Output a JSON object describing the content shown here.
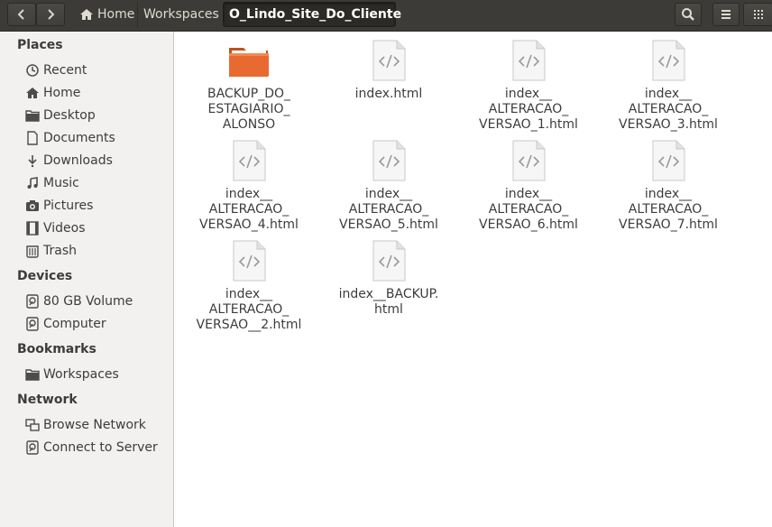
{
  "header": {
    "back_icon": "chevron-left",
    "forward_icon": "chevron-right",
    "breadcrumbs": [
      "Home",
      "Workspaces",
      "O_Lindo_Site_Do_Cliente"
    ],
    "search_icon": "search",
    "menu_icon": "hamburger",
    "view_icon": "grid"
  },
  "sidebar": {
    "places_title": "Places",
    "places": [
      "Recent",
      "Home",
      "Desktop",
      "Documents",
      "Downloads",
      "Music",
      "Pictures",
      "Videos",
      "Trash"
    ],
    "devices_title": "Devices",
    "devices": [
      "80 GB Volume",
      "Computer"
    ],
    "bookmarks_title": "Bookmarks",
    "bookmarks": [
      "Workspaces"
    ],
    "network_title": "Network",
    "network": [
      "Browse Network",
      "Connect to Server"
    ]
  },
  "files": [
    {
      "name": "BACKUP_DO_\nESTAGIARIO_\nALONSO",
      "type": "folder"
    },
    {
      "name": "index.html",
      "type": "html"
    },
    {
      "name": "index__\nALTERACAO_\nVERSAO_1.html",
      "type": "html"
    },
    {
      "name": "index__\nALTERACAO_\nVERSAO_3.html",
      "type": "html"
    },
    {
      "name": "index__\nALTERACAO_\nVERSAO_4.html",
      "type": "html"
    },
    {
      "name": "index__\nALTERACAO_\nVERSAO_5.html",
      "type": "html"
    },
    {
      "name": "index__\nALTERACAO_\nVERSAO_6.html",
      "type": "html"
    },
    {
      "name": "index__\nALTERACAO_\nVERSAO_7.html",
      "type": "html"
    },
    {
      "name": "index__\nALTERACAO_\nVERSAO__2.html",
      "type": "html"
    },
    {
      "name": "index__BACKUP.\nhtml",
      "type": "html"
    }
  ],
  "colors": {
    "headerbar": "#3c3b37",
    "sidebar": "#f2f1f0",
    "folder": "#e86a31"
  }
}
